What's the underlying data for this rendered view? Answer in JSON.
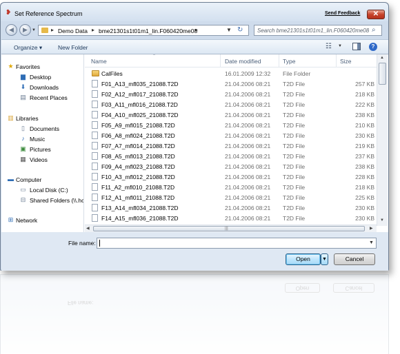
{
  "window": {
    "title": "Set Reference Spectrum",
    "send_feedback": "Send Feedback",
    "close_label": "✕"
  },
  "address": {
    "crumbs": [
      "Demo Data",
      "bme21301s1t01m1_lin.F060420me08"
    ],
    "search_placeholder": "Search bme21301s1t01m1_lin.F060420me08"
  },
  "toolbar": {
    "organize": "Organize ▾",
    "new_folder": "New Folder"
  },
  "navpane": {
    "items": [
      {
        "label": "Favorites",
        "icon": "star-icon"
      },
      {
        "label": "Desktop",
        "icon": "desktop-icon"
      },
      {
        "label": "Downloads",
        "icon": "downloads-icon"
      },
      {
        "label": "Recent Places",
        "icon": "recent-places-icon"
      },
      {
        "label": "Libraries",
        "icon": "libraries-icon"
      },
      {
        "label": "Documents",
        "icon": "documents-icon"
      },
      {
        "label": "Music",
        "icon": "music-icon"
      },
      {
        "label": "Pictures",
        "icon": "pictures-icon"
      },
      {
        "label": "Videos",
        "icon": "videos-icon"
      },
      {
        "label": "Computer",
        "icon": "computer-icon"
      },
      {
        "label": "Local Disk (C:)",
        "icon": "disk-icon"
      },
      {
        "label": "Shared Folders (\\\\.hc",
        "icon": "shared-folder-icon"
      },
      {
        "label": "Network",
        "icon": "network-icon"
      }
    ]
  },
  "columns": {
    "name": "Name",
    "date": "Date modified",
    "type": "Type",
    "size": "Size"
  },
  "files": [
    {
      "name": "CalFiles",
      "date": "16.01.2009 12:32",
      "type": "File Folder",
      "size": "",
      "kind": "folder"
    },
    {
      "name": "F01_A13_mfl035_21088.T2D",
      "date": "21.04.2006 08:21",
      "type": "T2D File",
      "size": "257 KB",
      "kind": "file"
    },
    {
      "name": "F02_A12_mfl017_21088.T2D",
      "date": "21.04.2006 08:21",
      "type": "T2D File",
      "size": "218 KB",
      "kind": "file"
    },
    {
      "name": "F03_A11_mfl016_21088.T2D",
      "date": "21.04.2006 08:21",
      "type": "T2D File",
      "size": "222 KB",
      "kind": "file"
    },
    {
      "name": "F04_A10_mfl025_21088.T2D",
      "date": "21.04.2006 08:21",
      "type": "T2D File",
      "size": "238 KB",
      "kind": "file"
    },
    {
      "name": "F05_A9_mfl015_21088.T2D",
      "date": "21.04.2006 08:21",
      "type": "T2D File",
      "size": "210 KB",
      "kind": "file"
    },
    {
      "name": "F06_A8_mfl024_21088.T2D",
      "date": "21.04.2006 08:21",
      "type": "T2D File",
      "size": "230 KB",
      "kind": "file"
    },
    {
      "name": "F07_A7_mfl014_21088.T2D",
      "date": "21.04.2006 08:21",
      "type": "T2D File",
      "size": "219 KB",
      "kind": "file"
    },
    {
      "name": "F08_A5_mfl013_21088.T2D",
      "date": "21.04.2006 08:21",
      "type": "T2D File",
      "size": "237 KB",
      "kind": "file"
    },
    {
      "name": "F09_A4_mfl023_21088.T2D",
      "date": "21.04.2006 08:21",
      "type": "T2D File",
      "size": "238 KB",
      "kind": "file"
    },
    {
      "name": "F10_A3_mfl012_21088.T2D",
      "date": "21.04.2006 08:21",
      "type": "T2D File",
      "size": "228 KB",
      "kind": "file"
    },
    {
      "name": "F11_A2_mfl010_21088.T2D",
      "date": "21.04.2006 08:21",
      "type": "T2D File",
      "size": "218 KB",
      "kind": "file"
    },
    {
      "name": "F12_A1_mfl011_21088.T2D",
      "date": "21.04.2006 08:21",
      "type": "T2D File",
      "size": "225 KB",
      "kind": "file"
    },
    {
      "name": "F13_A14_mfl034_21088.T2D",
      "date": "21.04.2006 08:21",
      "type": "T2D File",
      "size": "230 KB",
      "kind": "file"
    },
    {
      "name": "F14_A15_mfl036_21088.T2D",
      "date": "21.04.2006 08:21",
      "type": "T2D File",
      "size": "230 KB",
      "kind": "file"
    }
  ],
  "footer": {
    "filename_label": "File name:",
    "filename_value": "",
    "open_label": "Open",
    "cancel_label": "Cancel"
  },
  "colors": {
    "window_frame": "#cfdcec",
    "close_button": "#c6432b",
    "folder": "#e1a93a",
    "open_button": "#bee6fd"
  }
}
